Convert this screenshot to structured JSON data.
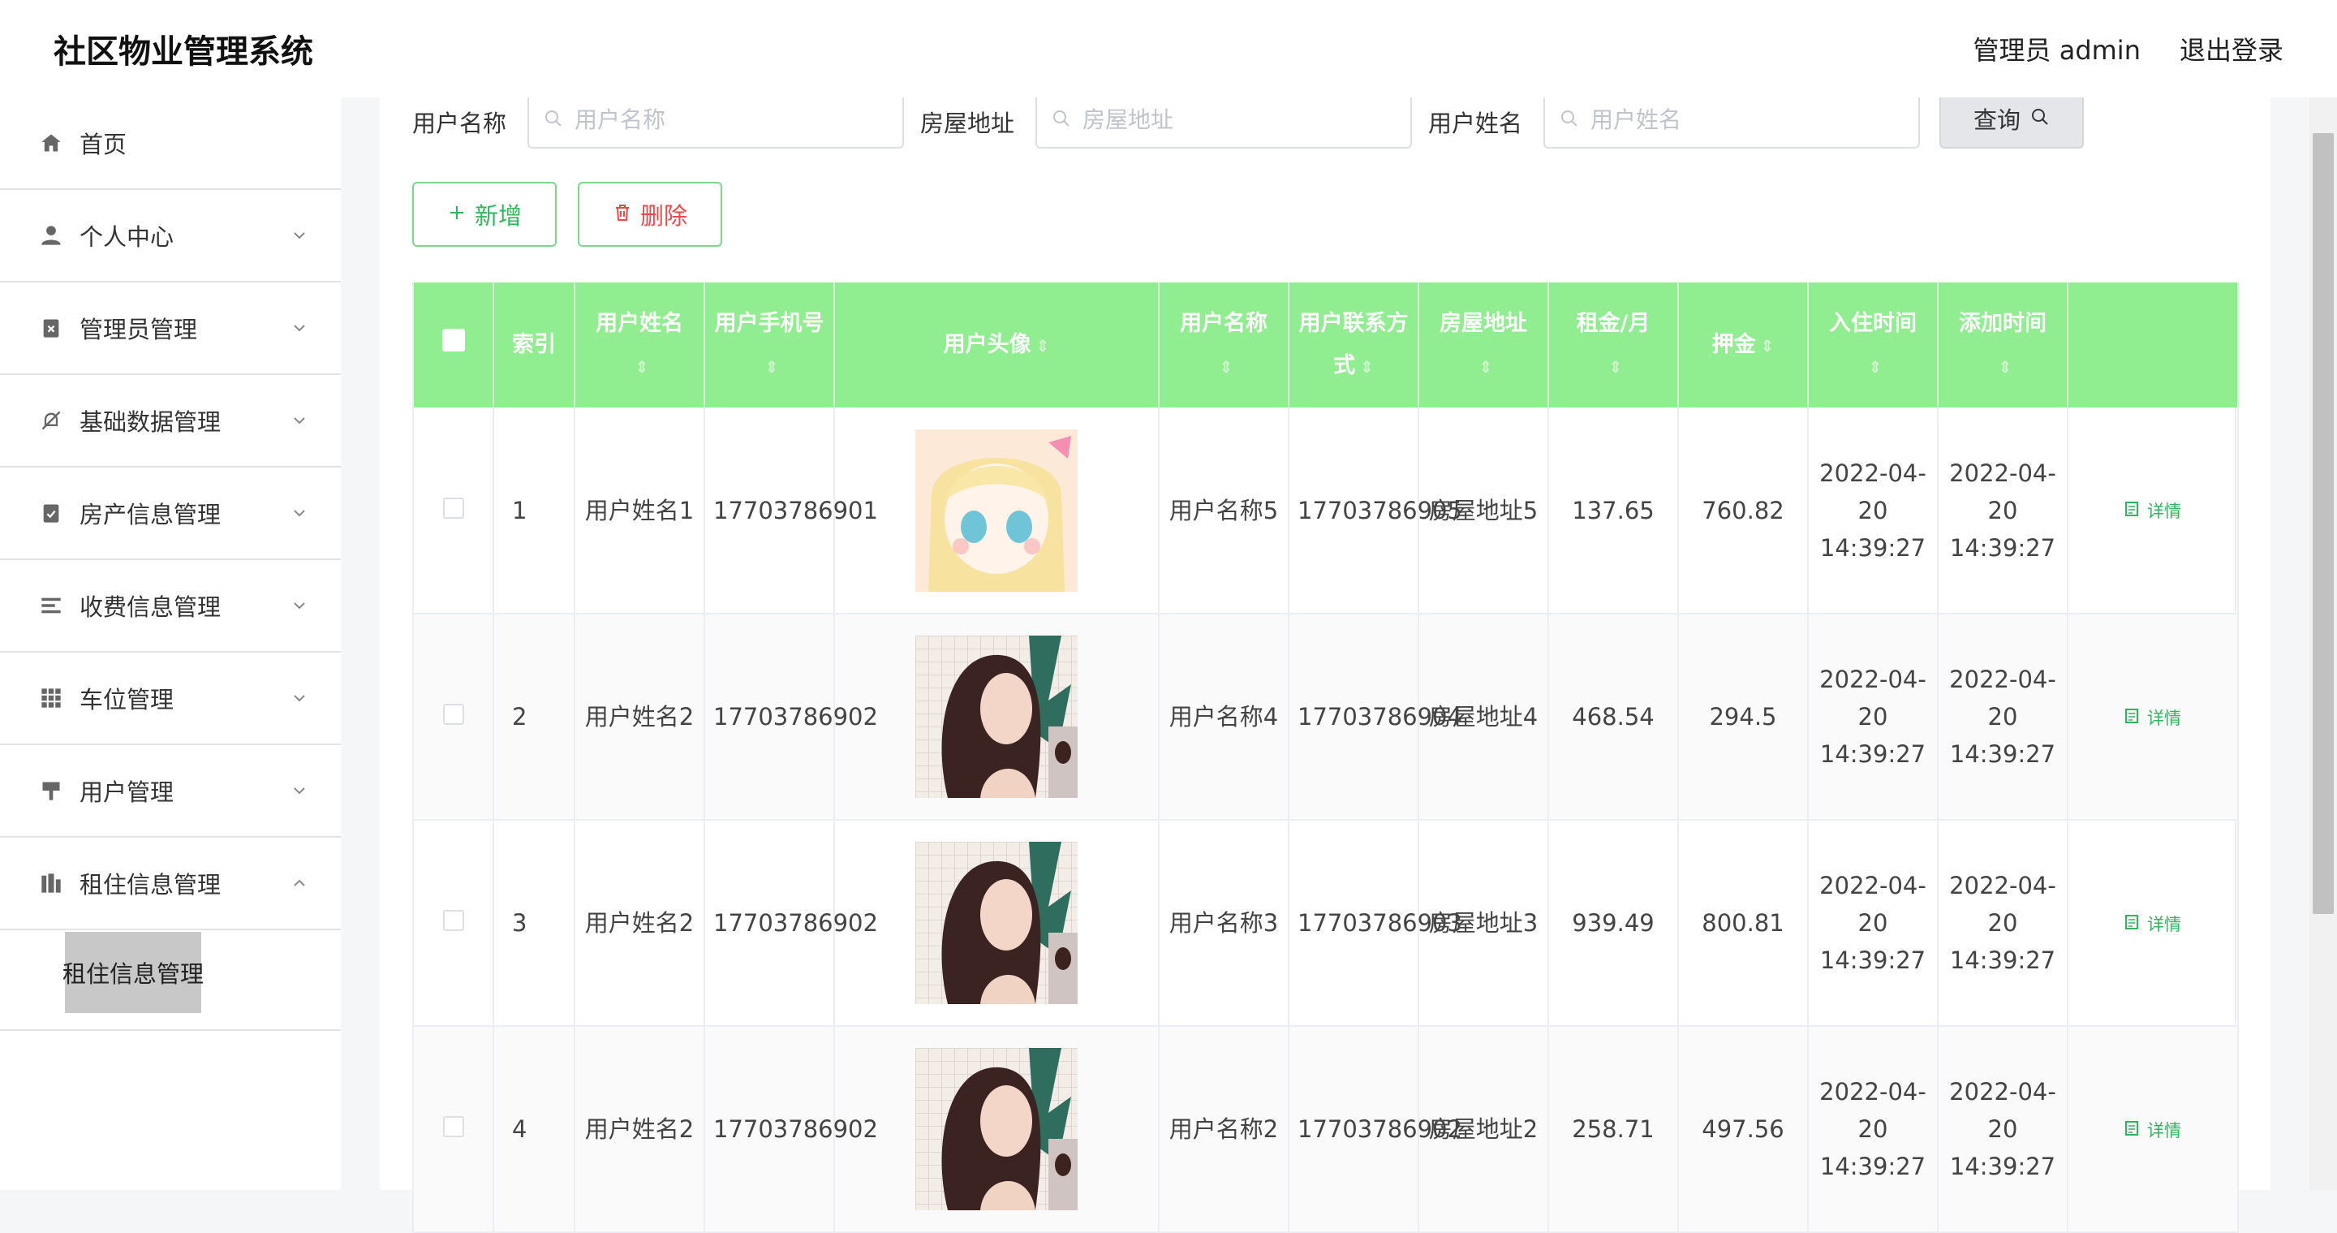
{
  "header": {
    "title": "社区物业管理系统",
    "user": "管理员 admin",
    "logout": "退出登录"
  },
  "sidebar": {
    "items": [
      {
        "label": "首页",
        "icon": "home-icon"
      },
      {
        "label": "个人中心",
        "icon": "person-icon"
      },
      {
        "label": "管理员管理",
        "icon": "clipboard-x-icon"
      },
      {
        "label": "基础数据管理",
        "icon": "bell-off-icon"
      },
      {
        "label": "房产信息管理",
        "icon": "clipboard-check-icon"
      },
      {
        "label": "收费信息管理",
        "icon": "list-icon"
      },
      {
        "label": "车位管理",
        "icon": "grid-icon"
      },
      {
        "label": "用户管理",
        "icon": "brush-icon"
      },
      {
        "label": "租住信息管理",
        "icon": "building-icon"
      }
    ],
    "submenu_active": "租住信息管理"
  },
  "search": {
    "fields": [
      {
        "label": "用户名称",
        "placeholder": "用户名称"
      },
      {
        "label": "房屋地址",
        "placeholder": "房屋地址"
      },
      {
        "label": "用户姓名",
        "placeholder": "用户姓名"
      }
    ],
    "button": "查询"
  },
  "actions": {
    "add": "新增",
    "delete": "删除"
  },
  "table": {
    "headers": [
      "索引",
      "用户姓名",
      "用户手机号",
      "用户头像",
      "用户名称",
      "用户联系方式",
      "房屋地址",
      "租金/月",
      "押金",
      "入住时间",
      "添加时间"
    ],
    "detail_label": "详情",
    "rows": [
      {
        "index": "1",
        "name": "用户姓名1",
        "phone": "17703786901",
        "avatar": "anime-girl",
        "username": "用户名称5",
        "contact": "17703786905",
        "address": "房屋地址5",
        "rent": "137.65",
        "deposit": "760.82",
        "checkin": "2022-04-20 14:39:27",
        "added": "2022-04-20 14:39:27"
      },
      {
        "index": "2",
        "name": "用户姓名2",
        "phone": "17703786902",
        "avatar": "woman-portrait",
        "username": "用户名称4",
        "contact": "17703786904",
        "address": "房屋地址4",
        "rent": "468.54",
        "deposit": "294.5",
        "checkin": "2022-04-20 14:39:27",
        "added": "2022-04-20 14:39:27"
      },
      {
        "index": "3",
        "name": "用户姓名2",
        "phone": "17703786902",
        "avatar": "woman-portrait",
        "username": "用户名称3",
        "contact": "17703786903",
        "address": "房屋地址3",
        "rent": "939.49",
        "deposit": "800.81",
        "checkin": "2022-04-20 14:39:27",
        "added": "2022-04-20 14:39:27"
      },
      {
        "index": "4",
        "name": "用户姓名2",
        "phone": "17703786902",
        "avatar": "woman-portrait",
        "username": "用户名称2",
        "contact": "17703786902",
        "address": "房屋地址2",
        "rent": "258.71",
        "deposit": "497.56",
        "checkin": "2022-04-20 14:39:27",
        "added": "2022-04-20 14:39:27"
      }
    ]
  },
  "colors": {
    "header_green": "#90ee90",
    "accent_green": "#2eb85c",
    "danger": "#f04848"
  }
}
